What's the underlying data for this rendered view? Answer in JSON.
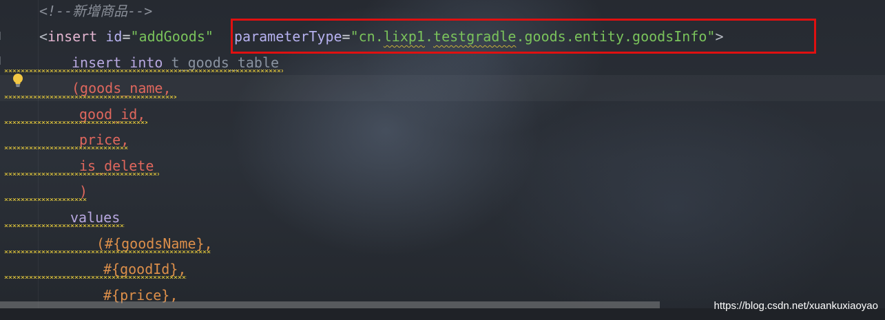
{
  "editor": {
    "comment": "<!--新增商品-->",
    "insert_open_bracket": "<",
    "insert_tag": "insert",
    "id_attr": "id",
    "id_eq": "=",
    "id_value": "\"addGoods\"",
    "param_attr": "parameterType",
    "param_eq": "=",
    "param_value_open": "\"cn.",
    "param_value_lixp": "lixp1",
    "param_value_dot": ".",
    "param_value_gradle": "testgradle",
    "param_value_rest": ".goods.entity.goodsInfo\"",
    "tag_close": ">",
    "insert_kw": "insert",
    "into_kw": "into",
    "table_name": "t_goods_table",
    "col_open": "(goods_name,",
    "col_good_id": "good_id,",
    "col_price": "price,",
    "col_is_delete": "is_delete",
    "col_close": ")",
    "values_kw": "values",
    "val_goods_name": "(#{goodsName},",
    "val_good_id": "#{goodId},",
    "val_price": "#{price},"
  },
  "watermark": "https://blog.csdn.net/xuankuxiaoyao",
  "colors": {
    "highlight_box": "#e01010",
    "string_value": "#7ac35b",
    "sql_column": "#e0675d",
    "sql_placeholder": "#dd8f4a",
    "warning_squiggle": "#c9b23a"
  },
  "icons": {
    "intention_bulb": "lightbulb-icon"
  }
}
